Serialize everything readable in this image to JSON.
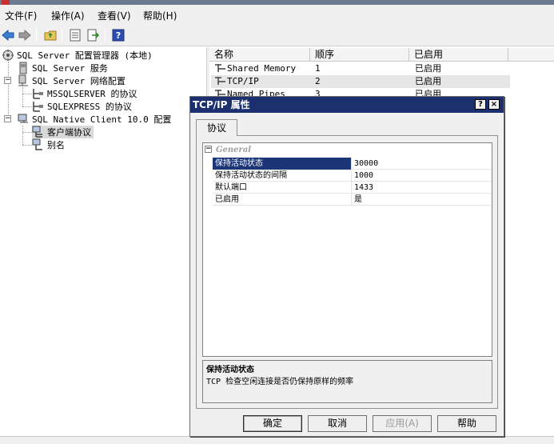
{
  "menubar": {
    "items": [
      "文件(F)",
      "操作(A)",
      "查看(V)",
      "帮助(H)"
    ]
  },
  "toolbar": {
    "buttons": [
      "back-icon",
      "forward-icon",
      "up-folder-icon",
      "properties-icon",
      "export-list-icon",
      "help-icon"
    ]
  },
  "tree": {
    "root": "SQL Server 配置管理器 (本地)",
    "services": "SQL Server 服务",
    "network": "SQL Server 网络配置",
    "mssqlserver": "MSSQLSERVER 的协议",
    "sqlexpress": "SQLEXPRESS 的协议",
    "native_client": "SQL Native Client 10.0 配置",
    "client_protocols": "客户端协议",
    "aliases": "别名"
  },
  "listview": {
    "columns": [
      "名称",
      "顺序",
      "已启用"
    ],
    "rows": [
      {
        "name": "Shared Memory",
        "order": "1",
        "enabled": "已启用"
      },
      {
        "name": "TCP/IP",
        "order": "2",
        "enabled": "已启用"
      },
      {
        "name": "Named Pipes",
        "order": "3",
        "enabled": "已启用"
      }
    ]
  },
  "dialog": {
    "title": "TCP/IP 属性",
    "help_btn": "?",
    "close_btn": "×",
    "tab": "协议",
    "category": "General",
    "category_toggle": "−",
    "properties": [
      {
        "name": "保持活动状态",
        "value": "30000"
      },
      {
        "name": "保持活动状态的间隔",
        "value": "1000"
      },
      {
        "name": "默认端口",
        "value": "1433"
      },
      {
        "name": "已启用",
        "value": "是"
      }
    ],
    "desc_title": "保持活动状态",
    "desc_text": "TCP 检查空闲连接是否仍保持原样的频率",
    "buttons": {
      "ok": "确定",
      "cancel": "取消",
      "apply": "应用(A)",
      "help": "帮助"
    }
  },
  "colors": {
    "dialog_title_bg": "#1c2f6e",
    "selection": "#1c3577"
  }
}
